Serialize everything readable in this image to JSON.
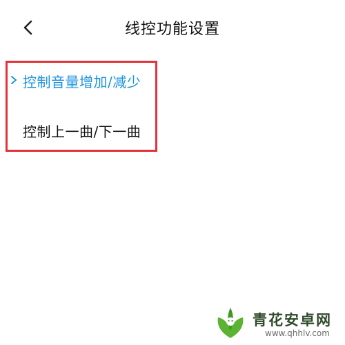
{
  "header": {
    "title": "线控功能设置",
    "back_icon": "chevron-left-icon"
  },
  "options": {
    "items": [
      {
        "label": "控制音量增加/减少",
        "selected": true,
        "indicator_icon": "chevron-right-icon"
      },
      {
        "label": "控制上一曲/下一曲",
        "selected": false
      }
    ]
  },
  "watermark": {
    "name": "青花安卓网",
    "url": "www.qhhlv.com"
  },
  "colors": {
    "selected": "#1a93e0",
    "highlight_box": "#e2323a",
    "text": "#111111"
  }
}
